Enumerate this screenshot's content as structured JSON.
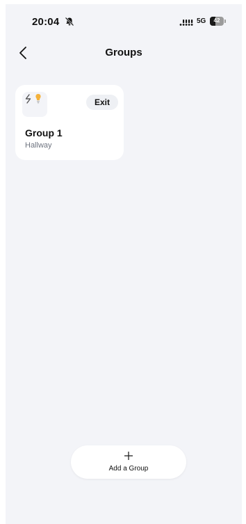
{
  "status_bar": {
    "time": "20:04",
    "network": "5G",
    "battery_level": "42",
    "battery_fraction": 0.42,
    "icons": [
      "bell-muted-icon",
      "signal-icon",
      "battery-icon"
    ]
  },
  "nav": {
    "title": "Groups",
    "back_icon": "chevron-left-icon"
  },
  "groups": [
    {
      "name": "Group 1",
      "room": "Hallway",
      "exit_label": "Exit",
      "device_icons": [
        "switch-icon",
        "bulb-icon"
      ],
      "bulb_color": "#f4b23c"
    }
  ],
  "add_group": {
    "label": "Add a Group",
    "icon": "plus-icon"
  },
  "colors": {
    "background": "#f3f4f8",
    "card": "#ffffff",
    "text": "#111111",
    "subtext": "#6f7480"
  }
}
